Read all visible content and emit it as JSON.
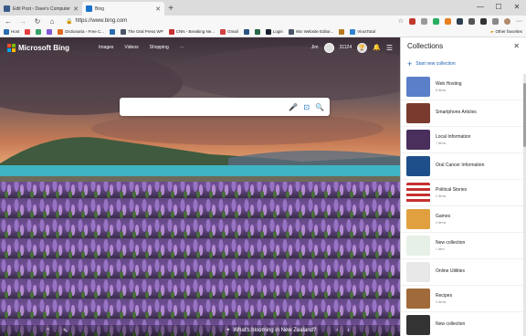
{
  "tabs": [
    {
      "title": "Edit Post ‹ Dave's Computer Tips",
      "active": false,
      "favicon_color": "#3a5a8c"
    },
    {
      "title": "Bing",
      "active": true,
      "favicon_color": "#1a73c9"
    }
  ],
  "address_bar": {
    "url": "https://www.bing.com"
  },
  "favorites": [
    {
      "label": "Host",
      "color": "#2b6cb0"
    },
    {
      "label": "",
      "color": "#e53e3e"
    },
    {
      "label": "",
      "color": "#38a169"
    },
    {
      "label": "",
      "color": "#805ad5"
    },
    {
      "label": "Dictionaria - Free C...",
      "color": "#dd6b20"
    },
    {
      "label": "",
      "color": "#2b6cb0"
    },
    {
      "label": "The Oral Press WP",
      "color": "#4a5568"
    },
    {
      "label": "CNN - Breaking Ne...",
      "color": "#c53030"
    },
    {
      "label": "Gmail",
      "color": "#d53f3f"
    },
    {
      "label": "",
      "color": "#2c5282"
    },
    {
      "label": "",
      "color": "#276749"
    },
    {
      "label": "Login",
      "color": "#1a202c"
    },
    {
      "label": "Wix Website Editor...",
      "color": "#4a5568"
    },
    {
      "label": "",
      "color": "#b7791f"
    },
    {
      "label": "VirusTotal",
      "color": "#3182ce"
    }
  ],
  "other_favorites": "Other favorites",
  "bing": {
    "logo_text": "Microsoft Bing",
    "nav": [
      "Images",
      "Videos",
      "Shopping",
      "···"
    ],
    "user": "Jim",
    "points": "31124",
    "caption": "What's blooming in New Zealand?"
  },
  "collections": {
    "title": "Collections",
    "new_label": "Start new collection",
    "items": [
      {
        "name": "Web Hosting",
        "count": "8 items",
        "thumb": "#5b7fc9"
      },
      {
        "name": "Smartphone Articles",
        "count": "",
        "thumb": "#7a3b2e"
      },
      {
        "name": "Local Information",
        "count": "7 items",
        "thumb": "#4a2f5c"
      },
      {
        "name": "Oral Cancer Information",
        "count": "",
        "thumb": "#1f4f8a"
      },
      {
        "name": "Political Stories",
        "count": "2 items",
        "thumb": "#c53030"
      },
      {
        "name": "Games",
        "count": "4 items",
        "thumb": "#e0a040"
      },
      {
        "name": "New collection",
        "count": "1 item",
        "thumb": "#8fbf8f"
      },
      {
        "name": "Online Utilities",
        "count": "",
        "thumb": "#e8e8e8"
      },
      {
        "name": "Recipes",
        "count": "3 items",
        "thumb": "#a06a3a"
      },
      {
        "name": "New collection",
        "count": "",
        "thumb": "#333333"
      }
    ]
  }
}
